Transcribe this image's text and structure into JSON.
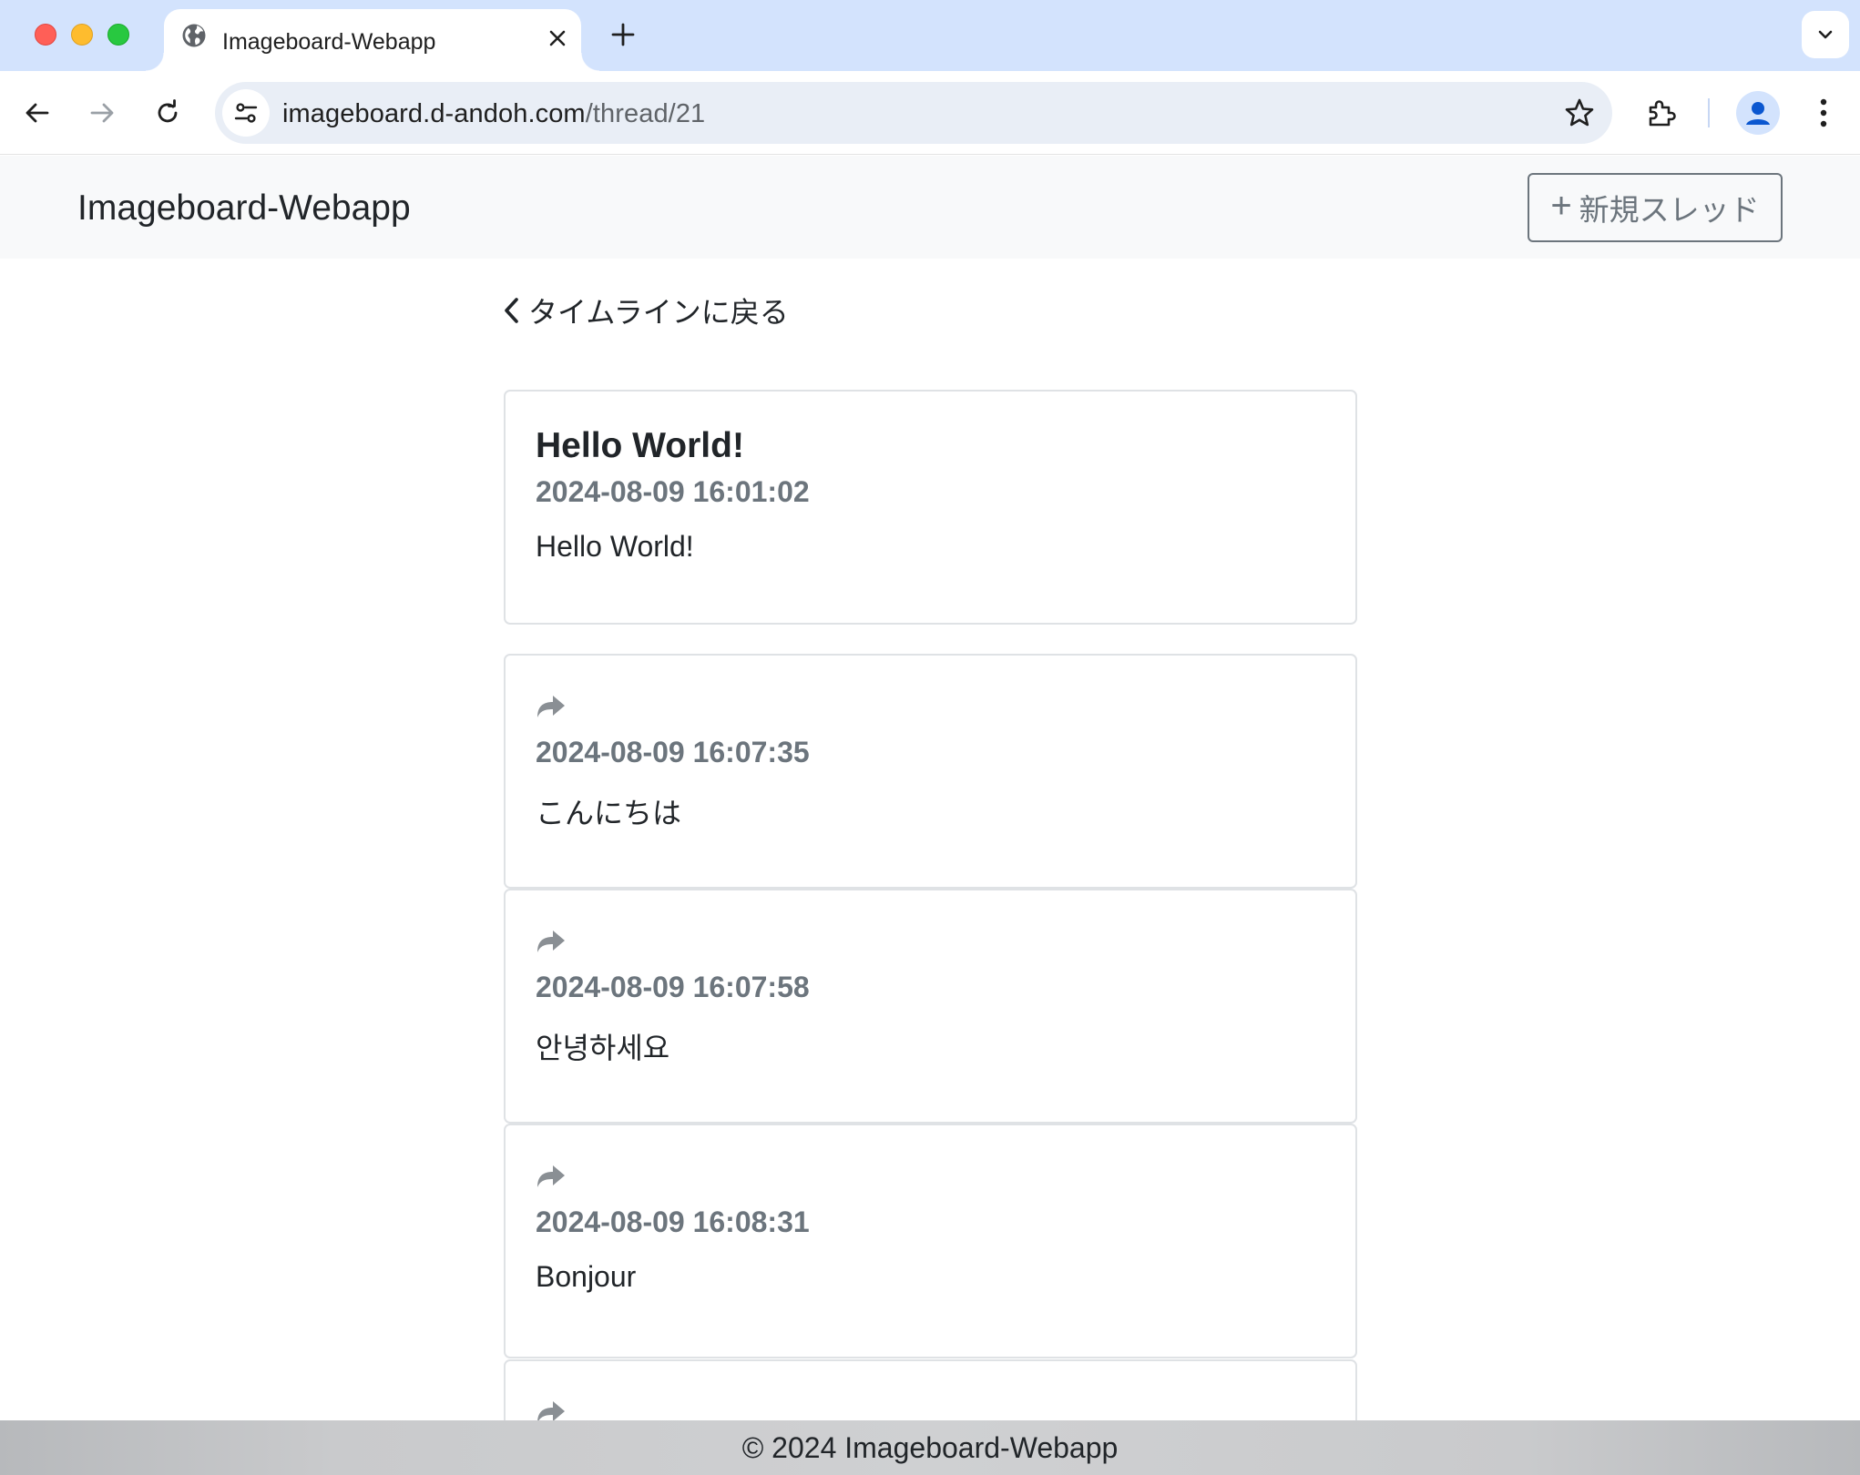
{
  "browser": {
    "tab_title": "Imageboard-Webapp",
    "url_host": "imageboard.d-andoh.com",
    "url_path": "/thread/21"
  },
  "navbar": {
    "brand": "Imageboard-Webapp",
    "new_thread_plus": "+",
    "new_thread_label": "新規スレッド"
  },
  "back_link": {
    "label": "タイムラインに戻る"
  },
  "thread": {
    "title": "Hello World!",
    "timestamp": "2024-08-09 16:01:02",
    "body": "Hello World!"
  },
  "replies": [
    {
      "timestamp": "2024-08-09 16:07:35",
      "body": "こんにちは"
    },
    {
      "timestamp": "2024-08-09 16:07:58",
      "body": "안녕하세요"
    },
    {
      "timestamp": "2024-08-09 16:08:31",
      "body": "Bonjour"
    }
  ],
  "footer": {
    "text": "© 2024 Imageboard-Webapp"
  },
  "colors": {
    "tabstrip": "#d3e3fd",
    "navbar_bg": "#f8f9fa",
    "muted_text": "#6c757d",
    "card_border": "#dfe2e5",
    "footer_bg": "#cfd0d2"
  }
}
